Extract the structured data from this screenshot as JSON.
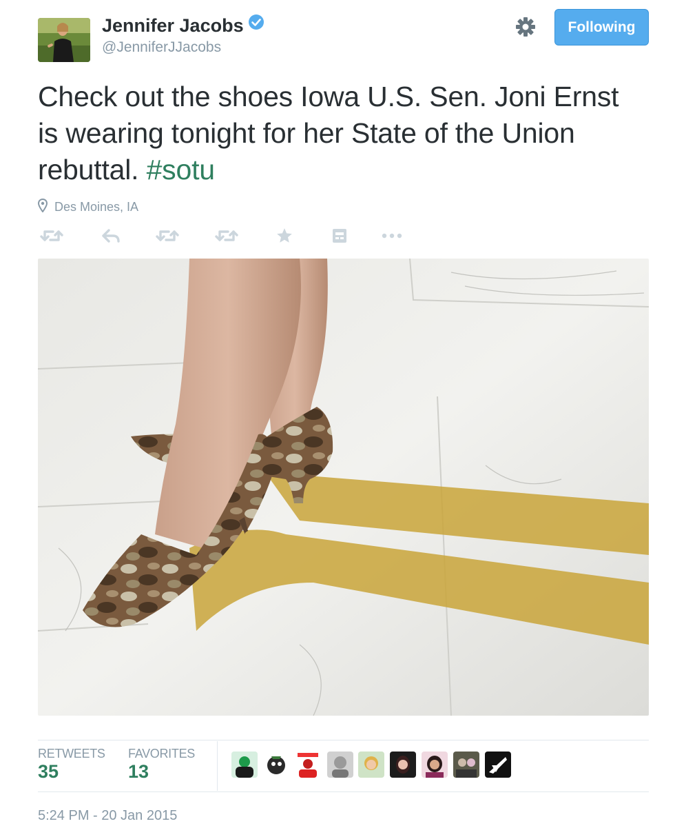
{
  "author": {
    "name": "Jennifer Jacobs",
    "handle": "@JenniferJJacobs",
    "verified": true
  },
  "header": {
    "follow_label": "Following",
    "settings_icon": "gear-icon"
  },
  "tweet": {
    "text": "Check out the shoes Iowa U.S. Sen. Joni Ernst is wearing tonight for her State of the Union rebuttal.",
    "hashtag": "#sotu",
    "location": "Des Moines, IA",
    "timestamp": "5:24 PM - 20 Jan 2015"
  },
  "actions": [
    "retweet-icon",
    "reply-icon",
    "retweet-icon",
    "retweet-icon",
    "favorite-star-icon",
    "embed-icon",
    "more-icon"
  ],
  "stats": {
    "retweets_label": "RETWEETS",
    "retweets_count": "35",
    "favorites_label": "FAVORITES",
    "favorites_count": "13"
  },
  "colors": {
    "follow_button": "#55acee",
    "hashtag": "#2f7f5f",
    "stat_value": "#2f7f5f",
    "muted": "#8899a6"
  }
}
